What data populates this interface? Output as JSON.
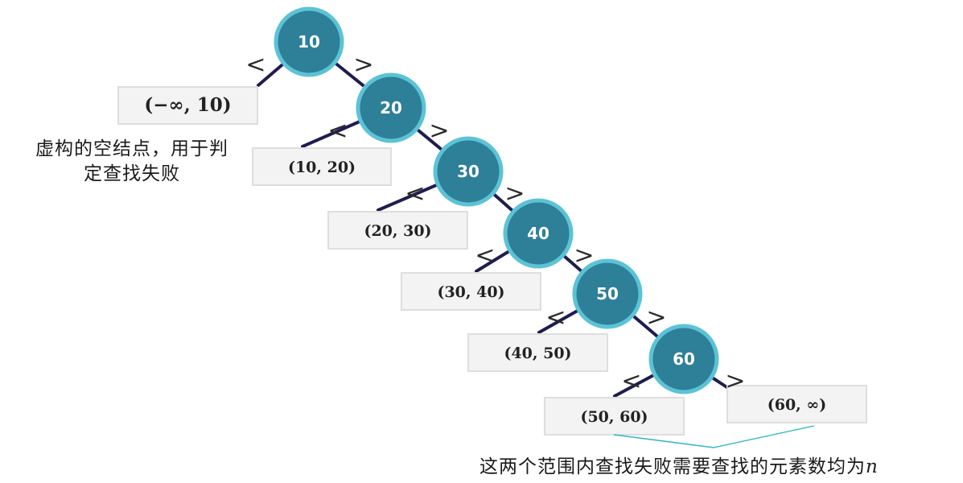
{
  "nodes": [
    "10",
    "20",
    "30",
    "40",
    "50",
    "60"
  ],
  "comparators": {
    "left": "<",
    "right": ">"
  },
  "leaves": [
    "(−∞, 10)",
    "(10, 20)",
    "(20, 30)",
    "(30, 40)",
    "(40, 50)",
    "(50, 60)",
    "(60, ∞)"
  ],
  "annotations": {
    "virtual_node_line1": "虚构的空结点，用于判",
    "virtual_node_line2": "定查找失败",
    "failure_cost_prefix": "这两个范围内查找失败需要查找的元素数均为",
    "failure_cost_var": "n"
  },
  "colors": {
    "node_fill": "#2e7f98",
    "node_ring": "#5cc3d6",
    "edge": "#1f1d4e",
    "leaf_fill": "#f3f3f3",
    "note_line": "#2fb6c4"
  }
}
